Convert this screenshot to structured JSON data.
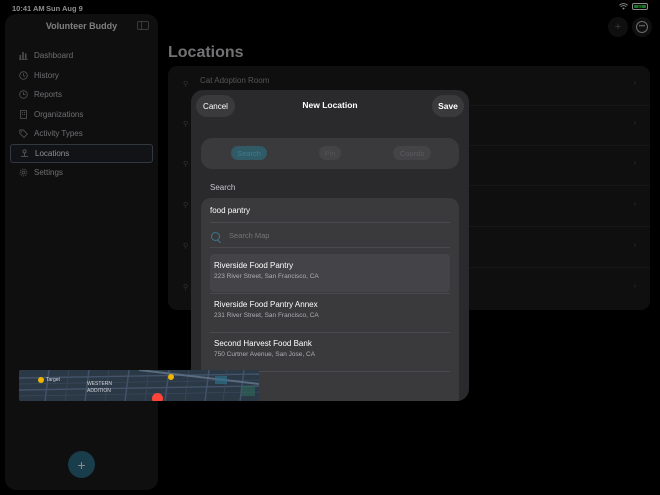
{
  "status": {
    "time": "10:41 AM",
    "date": "Sun Aug 9",
    "battery": "83"
  },
  "sidebar": {
    "title": "Volunteer Buddy",
    "items": [
      {
        "label": "Dashboard",
        "icon": "chart-bar-icon"
      },
      {
        "label": "History",
        "icon": "clock-arrow-icon"
      },
      {
        "label": "Reports",
        "icon": "clock-icon"
      },
      {
        "label": "Organizations",
        "icon": "building-icon"
      },
      {
        "label": "Activity Types",
        "icon": "tag-icon"
      },
      {
        "label": "Locations",
        "icon": "pin-icon",
        "active": true
      },
      {
        "label": "Settings",
        "icon": "gear-icon"
      }
    ],
    "add_button": "+"
  },
  "main": {
    "title": "Locations",
    "rows": [
      "Cat Adoption Room",
      "",
      "",
      "",
      "",
      ""
    ]
  },
  "sheet": {
    "cancel": "Cancel",
    "title": "New Location",
    "save": "Save",
    "segments": [
      "Search",
      "Pin",
      "Coords"
    ],
    "section_label": "Search",
    "query": "food pantry",
    "search_placeholder": "Search Map",
    "results": [
      {
        "name": "Riverside Food Pantry",
        "address": "223 River Street, San Francisco, CA"
      },
      {
        "name": "Riverside Food Pantry Annex",
        "address": "231 River Street, San Francisco, CA"
      },
      {
        "name": "Second Harvest Food Bank",
        "address": "750 Curtner Avenue, San Jose, CA"
      }
    ],
    "map_labels": {
      "target": "Target",
      "western": "WESTERN",
      "addition": "ADDITION"
    }
  }
}
